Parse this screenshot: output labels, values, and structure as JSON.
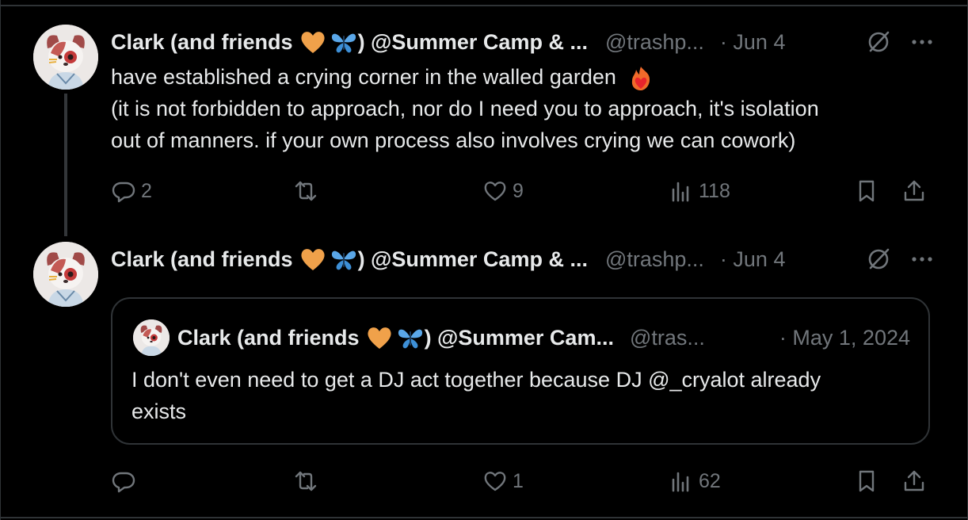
{
  "tweet1": {
    "author_name": "Clark (and friends",
    "author_suffix": ") @Summer Camp & ...",
    "handle": "@trashp...",
    "date": "· Jun 4",
    "text_line1": "have established a crying corner in the walled garden",
    "text_line2": "(it is not forbidden to approach, nor do I need you to approach, it's isolation",
    "text_line3": "out of manners. if your own process also involves crying we can cowork)",
    "replies": "2",
    "reposts": "",
    "likes": "9",
    "views": "118"
  },
  "tweet2": {
    "author_name": "Clark (and friends",
    "author_suffix": ") @Summer Camp & ...",
    "handle": "@trashp...",
    "date": "· Jun 4",
    "replies": "",
    "reposts": "",
    "likes": "1",
    "views": "62",
    "quote": {
      "author_name": "Clark (and friends",
      "author_suffix": ") @Summer Cam...",
      "handle": "@tras...",
      "date": "· May 1, 2024",
      "text_line1": "I don't even need to get a DJ act together because DJ @_cryalot already",
      "text_line2": "exists"
    }
  },
  "icons": {
    "heart_emoji_color": "#f0a14a",
    "butterfly_color": "#5aa7e8",
    "fire_color": "#e8442c",
    "secondary_text": "#71767b"
  }
}
